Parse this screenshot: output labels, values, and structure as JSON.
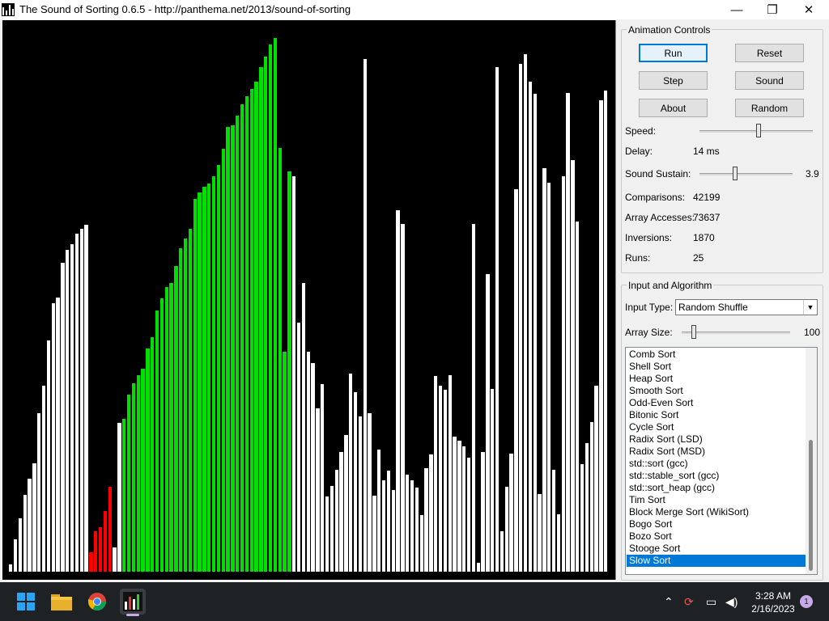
{
  "window": {
    "title": "The Sound of Sorting 0.6.5 - http://panthema.net/2013/sound-of-sorting",
    "minimize_glyph": "—",
    "maximize_glyph": "❐",
    "close_glyph": "✕"
  },
  "colors": {
    "unsorted": "#ffffff",
    "sorted": "#00e000",
    "compare": "#ff0000",
    "background": "#000000",
    "selection": "#0078d7"
  },
  "array": {
    "heights": [
      0.014,
      0.059,
      0.098,
      0.142,
      0.171,
      0.199,
      0.291,
      0.342,
      0.426,
      0.494,
      0.505,
      0.569,
      0.593,
      0.603,
      0.622,
      0.631,
      0.639,
      0.036,
      0.074,
      0.082,
      0.112,
      0.156,
      0.045,
      0.274,
      0.281,
      0.326,
      0.347,
      0.362,
      0.373,
      0.411,
      0.431,
      0.48,
      0.503,
      0.524,
      0.531,
      0.562,
      0.596,
      0.613,
      0.631,
      0.686,
      0.698,
      0.708,
      0.715,
      0.727,
      0.748,
      0.779,
      0.818,
      0.821,
      0.839,
      0.86,
      0.875,
      0.888,
      0.902,
      0.928,
      0.948,
      0.97,
      0.982,
      0.78,
      0.405,
      0.737,
      0.728,
      0.458,
      0.532,
      0.405,
      0.384,
      0.301,
      0.346,
      0.138,
      0.158,
      0.188,
      0.22,
      0.252,
      0.364,
      0.33,
      0.285,
      0.943,
      0.292,
      0.14,
      0.224,
      0.168,
      0.186,
      0.15,
      0.665,
      0.64,
      0.178,
      0.168,
      0.155,
      0.104,
      0.19,
      0.216,
      0.36,
      0.343,
      0.335,
      0.362,
      0.248,
      0.241,
      0.231,
      0.21,
      0.64,
      0.017,
      0.221,
      0.547,
      0.337,
      0.928,
      0.074,
      0.157,
      0.218,
      0.704,
      0.935,
      0.953,
      0.902,
      0.88,
      0.143,
      0.743,
      0.716,
      0.187,
      0.106,
      0.727,
      0.881,
      0.757,
      0.645,
      0.198,
      0.237,
      0.275,
      0.342,
      0.867,
      0.886
    ],
    "states": "uuuuuuuuuuuuuuuuucccccuugggggggggggggggggggggggggggggggggggguuuuuuuuuuuuuuuuuuuuuuuuuuuuuuuuuuuuuuuuuuuuuuuuuuuuuuuuuuuuuuuuuuuuuuu"
  },
  "animation": {
    "legend": "Animation Controls",
    "buttons": {
      "run": "Run",
      "reset": "Reset",
      "step": "Step",
      "sound": "Sound",
      "about": "About",
      "random": "Random"
    },
    "speed_label": "Speed:",
    "speed_level": 0.52,
    "delay_label": "Delay:",
    "delay_value": "14 ms",
    "sustain_label": "Sound Sustain:",
    "sustain_value": "3.9",
    "sustain_level": 0.38,
    "stats": [
      {
        "label": "Comparisons:",
        "value": "42199"
      },
      {
        "label": "Array Accesses:",
        "value": "73637"
      },
      {
        "label": "Inversions:",
        "value": "1870"
      },
      {
        "label": "Runs:",
        "value": "25"
      }
    ]
  },
  "input": {
    "legend": "Input and Algorithm",
    "input_type_label": "Input Type:",
    "input_type_value": "Random Shuffle",
    "array_size_label": "Array Size:",
    "array_size_value": "100",
    "array_size_level": 0.09,
    "algorithms": [
      "Comb Sort",
      "Shell Sort",
      "Heap Sort",
      "Smooth Sort",
      "Odd-Even Sort",
      "Bitonic Sort",
      "Cycle Sort",
      "Radix Sort (LSD)",
      "Radix Sort (MSD)",
      "std::sort (gcc)",
      "std::stable_sort (gcc)",
      "std::sort_heap (gcc)",
      "Tim Sort",
      "Block Merge Sort (WikiSort)",
      "Bogo Sort",
      "Bozo Sort",
      "Stooge Sort",
      "Slow Sort"
    ],
    "selected_algorithm": "Slow Sort"
  },
  "taskbar": {
    "icons": [
      "windows-start-icon",
      "file-explorer-icon",
      "chrome-icon",
      "sound-of-sorting-icon"
    ],
    "time": "3:28 AM",
    "date": "2/16/2023",
    "notification_count": "1"
  }
}
